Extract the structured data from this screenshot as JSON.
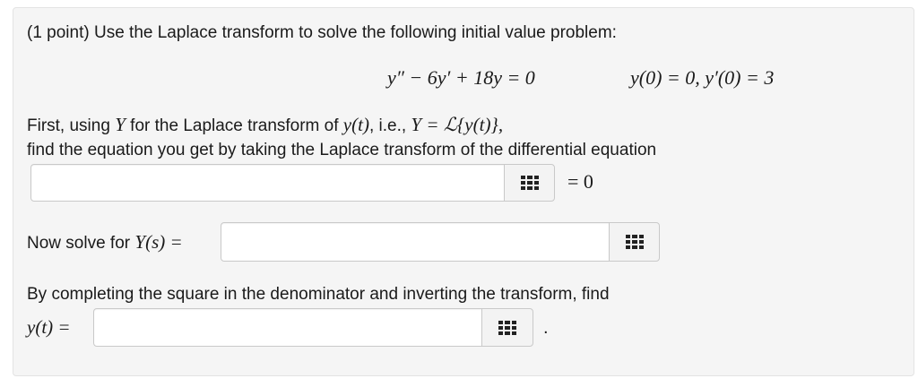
{
  "problem": {
    "intro": "(1 point) Use the Laplace transform to solve the following initial value problem:",
    "ode": "y″ − 6y′ + 18y = 0",
    "initial_conditions": "y(0) = 0,  y′(0) = 3"
  },
  "step1": {
    "line1_prefix": "First, using",
    "Y": "Y",
    "line1_mid": "for the Laplace transform of",
    "y_of_t": "y(t)",
    "ie": ", i.e.,",
    "def": "Y = ℒ{y(t)},",
    "line2": "find the equation you get by taking the Laplace transform of the differential equation",
    "input_value": "",
    "suffix": "= 0"
  },
  "step2": {
    "label_prefix": "Now solve for",
    "label_math": "Y(s) =",
    "input_value": ""
  },
  "step3": {
    "line1": "By completing the square in the denominator and inverting the transform, find",
    "label_math": "y(t) =",
    "input_value": "",
    "suffix": "."
  },
  "icons": {
    "palette": "equation-palette-grid-icon"
  }
}
